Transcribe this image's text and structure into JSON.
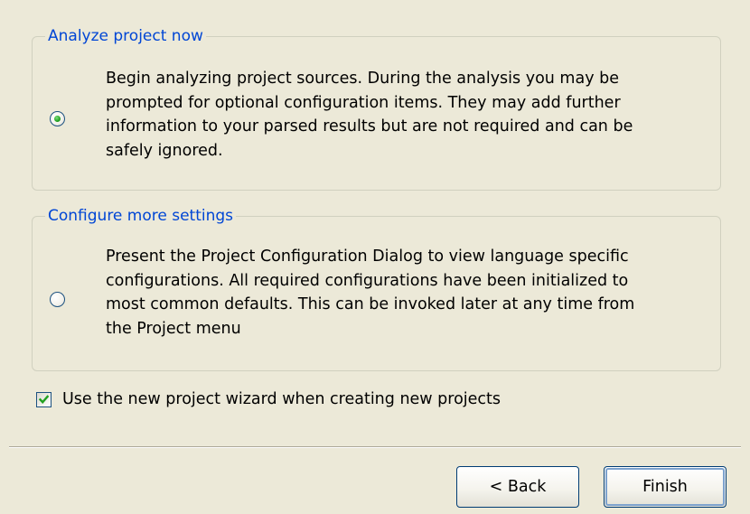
{
  "analyze_group": {
    "legend": "Analyze project now",
    "selected": true,
    "lines": [
      "Begin analyzing project sources.  During the analysis you may be",
      "prompted for optional configuration items. They may add further",
      "information to your parsed results but are not required and can be",
      "safely ignored."
    ]
  },
  "configure_group": {
    "legend": "Configure more settings",
    "selected": false,
    "lines": [
      "Present the Project Configuration Dialog to view language specific",
      "configurations.  All required configurations have been initialized to",
      "most common defaults.  This can be invoked later at any time from",
      "the Project menu"
    ]
  },
  "wizard_option": {
    "label": "Use the new project wizard when creating new projects",
    "checked": true
  },
  "buttons": {
    "back_label": "< Back",
    "finish_label": "Finish"
  },
  "colors": {
    "dialog_background": "#ece9d8",
    "group_title": "#0046d5",
    "control_border": "#1c5180",
    "radio_dot": "#21a121",
    "check_mark": "#21a121",
    "default_button_highlight": "#7da2ce"
  }
}
